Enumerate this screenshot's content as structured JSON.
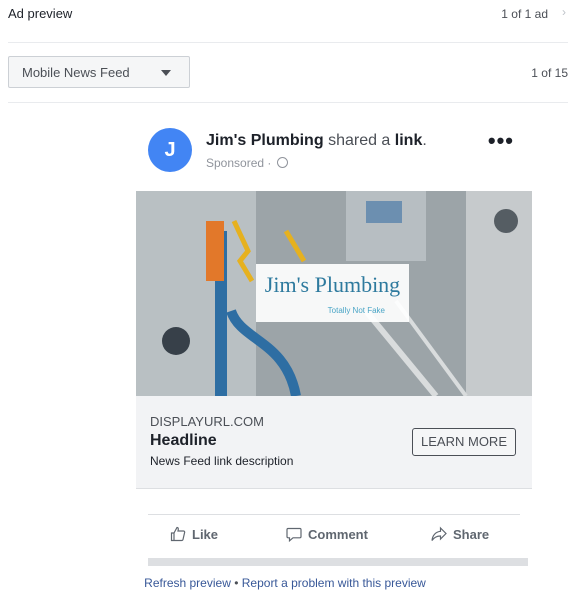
{
  "header": {
    "title": "Ad preview",
    "count": "1 of 1 ad"
  },
  "placement": {
    "selected": "Mobile News Feed",
    "page_count": "1 of 15"
  },
  "post": {
    "avatar_letter": "J",
    "page_name": "Jim's Plumbing",
    "action_text": "shared a",
    "link_word": "link",
    "period": ".",
    "sponsored": "Sponsored ·",
    "more": "•••"
  },
  "image": {
    "logo_title": "Jim's Plumbing",
    "logo_subtitle": "Totally Not Fake"
  },
  "link": {
    "display_url": "DISPLAYURL.COM",
    "headline": "Headline",
    "description": "News Feed link description",
    "cta": "LEARN MORE"
  },
  "actions": {
    "like": "Like",
    "comment": "Comment",
    "share": "Share"
  },
  "footer": {
    "refresh": "Refresh preview",
    "separator": "•",
    "report": "Report a problem with this preview"
  }
}
